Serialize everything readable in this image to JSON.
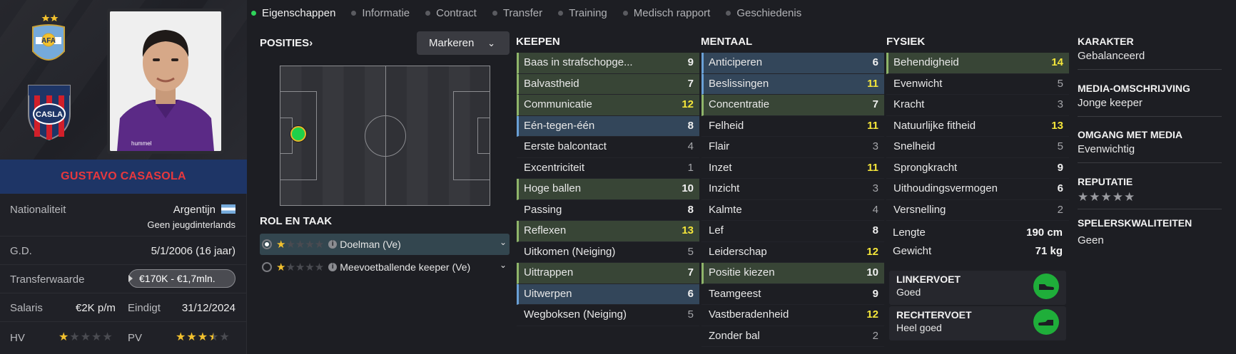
{
  "player": {
    "name": "GUSTAVO CASASOLA",
    "nationality_label": "Nationaliteit",
    "nationality": "Argentijn",
    "youth_caps": "Geen jeugdinterlands",
    "dob_label": "G.D.",
    "dob": "5/1/2006 (16 jaar)",
    "transfer_label": "Transferwaarde",
    "transfer_value": "€170K - €1,7mln.",
    "salary_label": "Salaris",
    "salary": "€2K p/m",
    "ends_label": "Eindigt",
    "ends": "31/12/2024",
    "ca_label": "HV",
    "ca_stars": 1,
    "pa_label": "PV",
    "pa_stars": 3.5,
    "crest_text": "CASLA",
    "afa_text": "AFA"
  },
  "tabs": [
    {
      "label": "Eigenschappen",
      "active": true
    },
    {
      "label": "Informatie",
      "active": false
    },
    {
      "label": "Contract",
      "active": false
    },
    {
      "label": "Transfer",
      "active": false
    },
    {
      "label": "Training",
      "active": false
    },
    {
      "label": "Medisch rapport",
      "active": false
    },
    {
      "label": "Geschiedenis",
      "active": false
    }
  ],
  "positions": {
    "title": "POSITIES",
    "chevron": "›",
    "markeren_label": "Markeren",
    "role_title": "ROL EN TAAK",
    "roles": [
      {
        "label": "Doelman (Ve)",
        "stars": 1,
        "selected": true
      },
      {
        "label": "Meevoetballende keeper (Ve)",
        "stars": 1,
        "selected": false
      }
    ]
  },
  "keepen": {
    "title": "KEEPEN",
    "items": [
      {
        "name": "Baas in strafschopge...",
        "value": "9",
        "hl": "green"
      },
      {
        "name": "Balvastheid",
        "value": "7",
        "hl": "green"
      },
      {
        "name": "Communicatie",
        "value": "12",
        "hl": "green"
      },
      {
        "name": "Eén-tegen-één",
        "value": "8",
        "hl": "blue"
      },
      {
        "name": "Eerste balcontact",
        "value": "4",
        "hl": ""
      },
      {
        "name": "Excentriciteit",
        "value": "1",
        "hl": ""
      },
      {
        "name": "Hoge ballen",
        "value": "10",
        "hl": "green"
      },
      {
        "name": "Passing",
        "value": "8",
        "hl": ""
      },
      {
        "name": "Reflexen",
        "value": "13",
        "hl": "green"
      },
      {
        "name": "Uitkomen (Neiging)",
        "value": "5",
        "hl": ""
      },
      {
        "name": "Uittrappen",
        "value": "7",
        "hl": "green"
      },
      {
        "name": "Uitwerpen",
        "value": "6",
        "hl": "blue"
      },
      {
        "name": "Wegboksen (Neiging)",
        "value": "5",
        "hl": ""
      }
    ]
  },
  "mentaal": {
    "title": "MENTAAL",
    "items": [
      {
        "name": "Anticiperen",
        "value": "6",
        "hl": "blue"
      },
      {
        "name": "Beslissingen",
        "value": "11",
        "hl": "blue"
      },
      {
        "name": "Concentratie",
        "value": "7",
        "hl": "green"
      },
      {
        "name": "Felheid",
        "value": "11",
        "hl": ""
      },
      {
        "name": "Flair",
        "value": "3",
        "hl": ""
      },
      {
        "name": "Inzet",
        "value": "11",
        "hl": ""
      },
      {
        "name": "Inzicht",
        "value": "3",
        "hl": ""
      },
      {
        "name": "Kalmte",
        "value": "4",
        "hl": ""
      },
      {
        "name": "Lef",
        "value": "8",
        "hl": ""
      },
      {
        "name": "Leiderschap",
        "value": "12",
        "hl": ""
      },
      {
        "name": "Positie kiezen",
        "value": "10",
        "hl": "green"
      },
      {
        "name": "Teamgeest",
        "value": "9",
        "hl": ""
      },
      {
        "name": "Vastberadenheid",
        "value": "12",
        "hl": ""
      },
      {
        "name": "Zonder bal",
        "value": "2",
        "hl": ""
      }
    ]
  },
  "fysiek": {
    "title": "FYSIEK",
    "items": [
      {
        "name": "Behendigheid",
        "value": "14",
        "hl": "green"
      },
      {
        "name": "Evenwicht",
        "value": "5",
        "hl": ""
      },
      {
        "name": "Kracht",
        "value": "3",
        "hl": ""
      },
      {
        "name": "Natuurlijke fitheid",
        "value": "13",
        "hl": ""
      },
      {
        "name": "Snelheid",
        "value": "5",
        "hl": ""
      },
      {
        "name": "Sprongkracht",
        "value": "9",
        "hl": ""
      },
      {
        "name": "Uithoudingsvermogen",
        "value": "6",
        "hl": ""
      },
      {
        "name": "Versnelling",
        "value": "2",
        "hl": ""
      }
    ],
    "height_label": "Lengte",
    "height": "190 cm",
    "weight_label": "Gewicht",
    "weight": "71 kg",
    "left_foot_label": "LINKERVOET",
    "left_foot": "Goed",
    "right_foot_label": "RECHTERVOET",
    "right_foot": "Heel goed"
  },
  "right": {
    "karakter_label": "KARAKTER",
    "karakter": "Gebalanceerd",
    "media_label": "MEDIA-OMSCHRIJVING",
    "media": "Jonge keeper",
    "omgang_label": "OMGANG MET MEDIA",
    "omgang": "Evenwichtig",
    "reputatie_label": "REPUTATIE",
    "reputatie_stars": 0,
    "kwaliteiten_label": "SPELERSKWALITEITEN",
    "kwaliteiten": "Geen"
  }
}
